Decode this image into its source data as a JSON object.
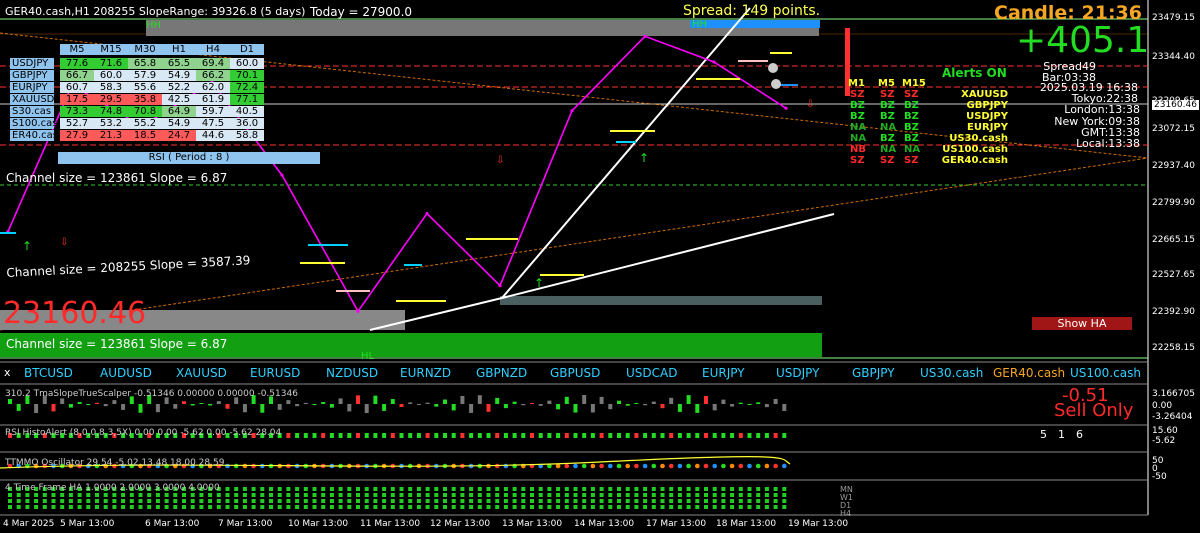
{
  "header": {
    "title_overlay": "GER40.cash,H1  208255 SlopeRange: 39326.8 (5 days)",
    "today_text": "Today = 27900.0",
    "spread_text": "Spread: 149 points.",
    "candle_text": "Candle:  21:36",
    "price_change": "+405.1",
    "big_price": "23160.46"
  },
  "info_panel": {
    "spread": "Spread49",
    "bar": "Bar:03:38",
    "datetime": "2025.03.19 16:38",
    "tokyo": "Tokyo:22:38",
    "london": "London:13:38",
    "newyork": "New York:09:38",
    "gmt": "GMT:13:38",
    "local": "Local:13:38"
  },
  "alerts": {
    "title": "Alerts ON",
    "headers": [
      "M1",
      "M5",
      "M15"
    ],
    "rows": [
      {
        "cells": [
          "SZ",
          "SZ",
          "SZ"
        ],
        "symbol": "XAUUSD"
      },
      {
        "cells": [
          "BZ",
          "BZ",
          "BZ"
        ],
        "symbol": "GBPJPY"
      },
      {
        "cells": [
          "BZ",
          "BZ",
          "BZ"
        ],
        "symbol": "USDJPY"
      },
      {
        "cells": [
          "NA",
          "NA",
          "BZ"
        ],
        "symbol": "EURJPY"
      },
      {
        "cells": [
          "NA",
          "BZ",
          "BZ"
        ],
        "symbol": "US30.cash"
      },
      {
        "cells": [
          "NB",
          "NA",
          "NA"
        ],
        "symbol": "US100.cash"
      },
      {
        "cells": [
          "SZ",
          "SZ",
          "SZ"
        ],
        "symbol": "GER40.cash"
      }
    ],
    "colors": {
      "SZ": "#ff2a2a",
      "BZ": "#22dd22",
      "NA": "#22aa22",
      "NB": "#ff2a2a"
    }
  },
  "rsi_table": {
    "headers": [
      "M5",
      "M15",
      "M30",
      "H1",
      "H4",
      "D1"
    ],
    "rows": [
      {
        "symbol": "USDJPY",
        "values": [
          "77.6",
          "71.6",
          "65.8",
          "65.5",
          "69.4",
          "60.0"
        ],
        "colors": [
          "#33cc33",
          "#33cc33",
          "#8fd38f",
          "#8fd38f",
          "#8fd38f",
          "#d8e8f5"
        ]
      },
      {
        "symbol": "GBPJPY",
        "values": [
          "66.7",
          "60.0",
          "57.9",
          "54.9",
          "66.2",
          "70.1"
        ],
        "colors": [
          "#8fd38f",
          "#d8e8f5",
          "#d8e8f5",
          "#d8e8f5",
          "#8fd38f",
          "#33cc33"
        ]
      },
      {
        "symbol": "EURJPY",
        "values": [
          "60.7",
          "58.3",
          "55.6",
          "52.2",
          "62.0",
          "72.4"
        ],
        "colors": [
          "#d8e8f5",
          "#d8e8f5",
          "#d8e8f5",
          "#d8e8f5",
          "#d8e8f5",
          "#33cc33"
        ]
      },
      {
        "symbol": "XAUUSD",
        "values": [
          "17.5",
          "29.5",
          "35.8",
          "42.5",
          "61.9",
          "77.1"
        ],
        "colors": [
          "#ff5a5a",
          "#ff5a5a",
          "#ff5a5a",
          "#d8e8f5",
          "#d8e8f5",
          "#33cc33"
        ]
      },
      {
        "symbol": "S30.cas",
        "values": [
          "73.3",
          "74.8",
          "70.8",
          "64.9",
          "59.7",
          "40.5"
        ],
        "colors": [
          "#33cc33",
          "#33cc33",
          "#33cc33",
          "#8fd38f",
          "#d8e8f5",
          "#d8e8f5"
        ]
      },
      {
        "symbol": "S100.cas",
        "values": [
          "52.7",
          "53.2",
          "55.2",
          "54.9",
          "47.5",
          "36.0"
        ],
        "colors": [
          "#d8e8f5",
          "#d8e8f5",
          "#d8e8f5",
          "#d8e8f5",
          "#d8e8f5",
          "#d8e8f5"
        ]
      },
      {
        "symbol": "ER40.cas",
        "values": [
          "27.9",
          "21.3",
          "18.5",
          "24.7",
          "44.6",
          "58.8"
        ],
        "colors": [
          "#ff5a5a",
          "#ff5a5a",
          "#ff5a5a",
          "#ff5a5a",
          "#d8e8f5",
          "#d8e8f5"
        ]
      }
    ],
    "footer": "RSI ( Period : 8 )"
  },
  "channel_labels": {
    "top": "Channel size = 123861 Slope = 6.87",
    "mid": "Channel size = 208255 Slope = 3587.39",
    "bottom": "Channel size = 123861 Slope = 6.87"
  },
  "marker_labels": {
    "hh_left": "HH",
    "hh_right": "HH",
    "hl": "HL"
  },
  "show_ha_label": "Show HA",
  "symbol_bar": [
    "BTCUSD",
    "AUDUSD",
    "XAUUSD",
    "EURUSD",
    "NZDUSD",
    "EURNZD",
    "GBPNZD",
    "GBPUSD",
    "USDCAD",
    "EURJPY",
    "USDJPY",
    "GBPJPY",
    "US30.cash",
    "GER40.cash",
    "US100.cash"
  ],
  "symbol_bar_close": "x",
  "indicators": {
    "tma_label": "310.2  TmaSlopeTrueScalper -0.51346 0.00000 0.00000 -0.51346",
    "tma_value": "-0.51",
    "tma_signal": "Sell Only",
    "tma_axis": [
      "3.166705",
      "0.00",
      "-3.26404"
    ],
    "rsi_histo_label": "RSI HistoAlert (8,0,0,8,3,5X) 0.00 0.00 -5.62 0.00 -5.62 28.04",
    "rsi_histo_values": [
      "5",
      "1",
      "6"
    ],
    "rsi_histo_axis": [
      "15.60",
      "-5.62"
    ],
    "tmmo_label": "TTMMO Oscillator 29.54 -5.02 13.48 18.00 28.59",
    "tmmo_axis": [
      "50",
      "0",
      "-50"
    ],
    "tf_label": "4 Time Frame HA 1.0000 2.0000 3.0000 4.0000",
    "tf_tags": [
      "MN",
      "W1",
      "D1",
      "H4"
    ]
  },
  "price_axis": [
    "23479.15",
    "23344.40",
    "23209.65",
    "23160.46",
    "23072.15",
    "22937.40",
    "22799.90",
    "22665.15",
    "22527.65",
    "22392.90",
    "22258.15"
  ],
  "date_axis": [
    "4 Mar 2025",
    "5 Mar 13:00",
    "6 Mar 13:00",
    "7 Mar 13:00",
    "10 Mar 13:00",
    "11 Mar 13:00",
    "12 Mar 13:00",
    "13 Mar 13:00",
    "14 Mar 13:00",
    "17 Mar 13:00",
    "18 Mar 13:00",
    "19 Mar 13:00"
  ],
  "colors": {
    "accent_gold": "#f5a623",
    "up_green": "#22dd22",
    "down_red": "#ff2a2a",
    "magenta_line": "#ff00ff",
    "cyan_text": "#2fd0ff"
  },
  "chart_data": {
    "type": "line",
    "title": "GER40.cash,H1",
    "series": [
      {
        "name": "",
        "x": [
          "4 Mar 2025",
          "5 Mar 13:00",
          "6 Mar 13:00",
          "7 Mar 13:00",
          "10 Mar 13:00",
          "11 Mar 13:00",
          "12 Mar 13:00",
          "13 Mar 13:00",
          "14 Mar 13:00",
          "17 Mar 13:00",
          "18 Mar 13:00",
          "19 Mar 13:00"
        ],
        "values": [
          22680,
          23250,
          23090,
          23260,
          22900,
          22370,
          22750,
          22470,
          23150,
          23440,
          23340,
          23160
        ]
      }
    ],
    "ylim": [
      22200,
      23550
    ],
    "xlabel": "",
    "ylabel": "",
    "grid": false
  }
}
